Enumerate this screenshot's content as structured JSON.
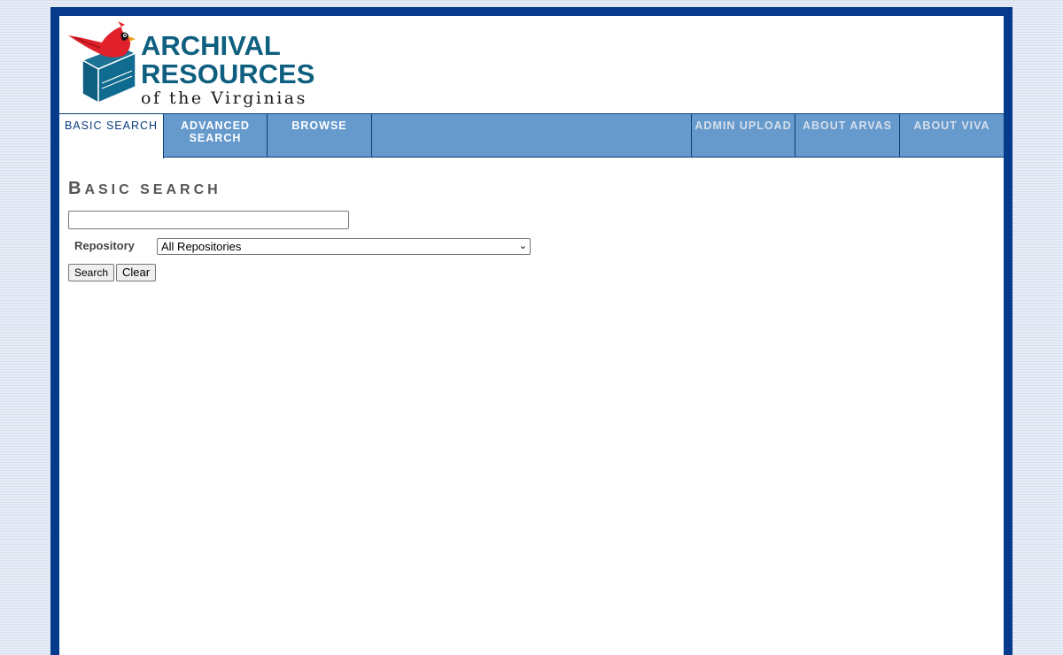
{
  "logo": {
    "line1": "ARCHIVAL",
    "line2": "RESOURCES",
    "line3": "of the Virginias",
    "colors": {
      "text": "#0e5f80",
      "box": "#0e5f80",
      "cardinal": "#e0202a"
    }
  },
  "nav": {
    "tabs": [
      {
        "label": "BASIC SEARCH",
        "active": true
      },
      {
        "label": "ADVANCED SEARCH",
        "active": false
      },
      {
        "label": "BROWSE",
        "active": false
      },
      {
        "label": "ADMIN UPLOAD",
        "active": false
      },
      {
        "label": "ABOUT ARVAS",
        "active": false
      },
      {
        "label": "ABOUT VIVA",
        "active": false
      }
    ],
    "colors": {
      "background": "#6699cc",
      "border": "#0b3c7e"
    }
  },
  "page": {
    "title_first": "B",
    "title_rest": "ASIC SEARCH",
    "search_value": "",
    "repository_label": "Repository",
    "repository_selected": "All Repositories",
    "search_button": "Search",
    "clear_button": "Clear"
  },
  "colors": {
    "frame": "#063a8c",
    "page_background": "#dfe6f2"
  }
}
